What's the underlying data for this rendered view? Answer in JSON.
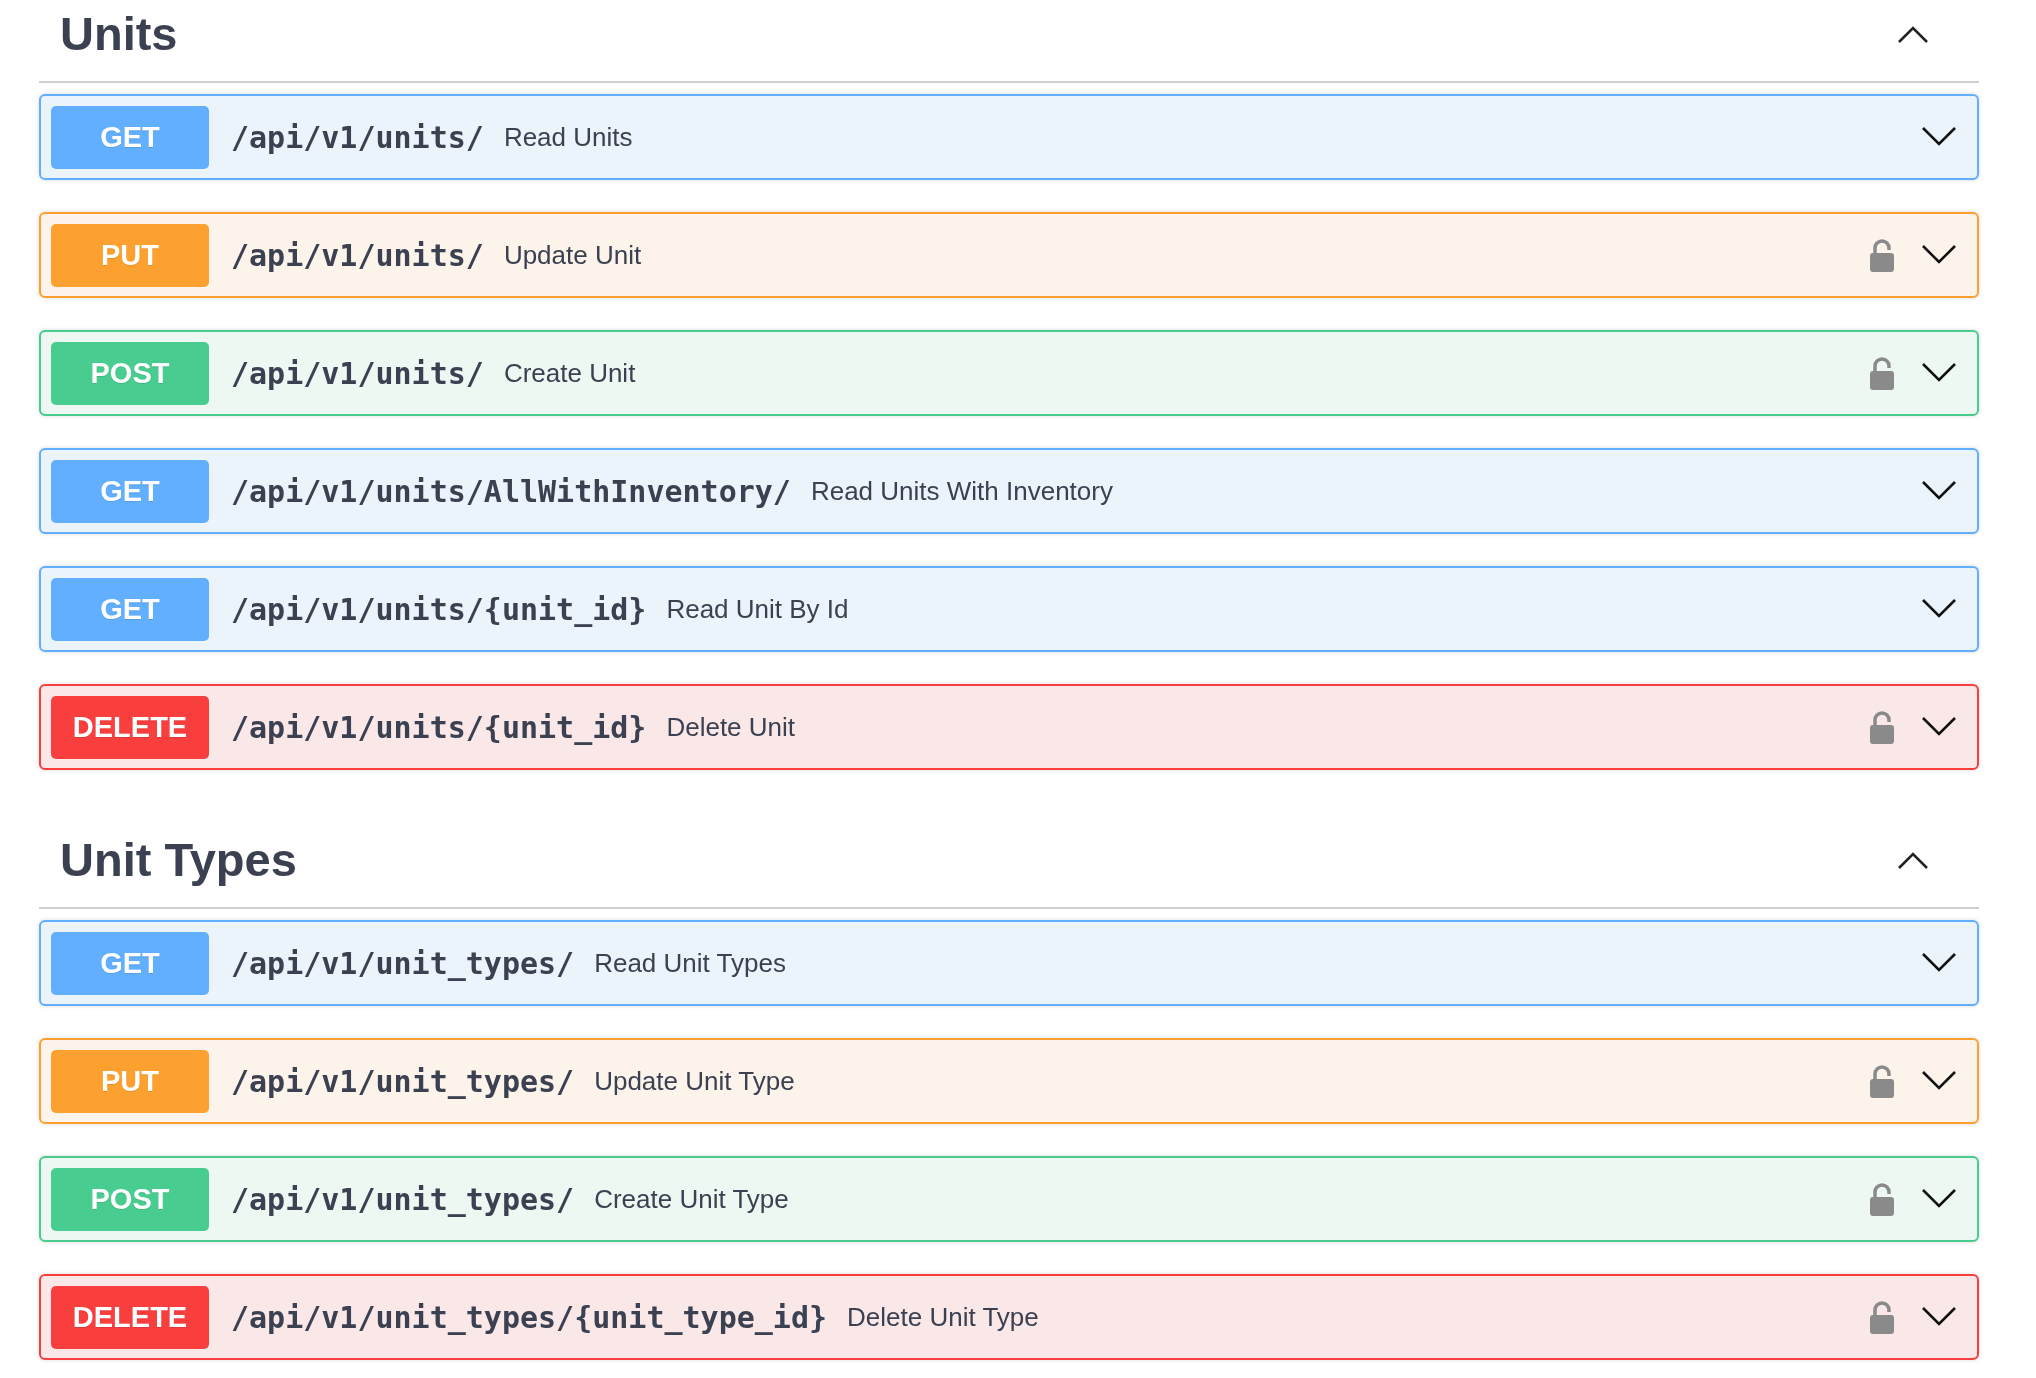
{
  "sections": [
    {
      "title": "Units",
      "expanded": true,
      "operations": [
        {
          "method": "GET",
          "kind": "get",
          "path": "/api/v1/units/",
          "summary": "Read Units",
          "locked": false,
          "expanded": false
        },
        {
          "method": "PUT",
          "kind": "put",
          "path": "/api/v1/units/",
          "summary": "Update Unit",
          "locked": true,
          "expanded": false
        },
        {
          "method": "POST",
          "kind": "post",
          "path": "/api/v1/units/",
          "summary": "Create Unit",
          "locked": true,
          "expanded": false
        },
        {
          "method": "GET",
          "kind": "get",
          "path": "/api/v1/units/AllWithInventory/",
          "summary": "Read Units With Inventory",
          "locked": false,
          "expanded": false
        },
        {
          "method": "GET",
          "kind": "get",
          "path": "/api/v1/units/{unit_id}",
          "summary": "Read Unit By Id",
          "locked": false,
          "expanded": false
        },
        {
          "method": "DELETE",
          "kind": "delete",
          "path": "/api/v1/units/{unit_id}",
          "summary": "Delete Unit",
          "locked": true,
          "expanded": false
        }
      ]
    },
    {
      "title": "Unit Types",
      "expanded": true,
      "operations": [
        {
          "method": "GET",
          "kind": "get",
          "path": "/api/v1/unit_types/",
          "summary": "Read Unit Types",
          "locked": false,
          "expanded": false
        },
        {
          "method": "PUT",
          "kind": "put",
          "path": "/api/v1/unit_types/",
          "summary": "Update Unit Type",
          "locked": true,
          "expanded": false
        },
        {
          "method": "POST",
          "kind": "post",
          "path": "/api/v1/unit_types/",
          "summary": "Create Unit Type",
          "locked": true,
          "expanded": false
        },
        {
          "method": "DELETE",
          "kind": "delete",
          "path": "/api/v1/unit_types/{unit_type_id}",
          "summary": "Delete Unit Type",
          "locked": true,
          "expanded": false
        }
      ]
    }
  ]
}
